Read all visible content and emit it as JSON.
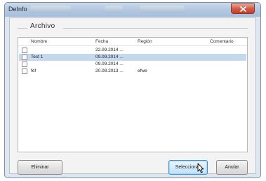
{
  "window": {
    "title": "DeInfo"
  },
  "group": {
    "title": "Archivo"
  },
  "list": {
    "columns": [
      "Nombre",
      "Fecha",
      "Región",
      "Comentario"
    ],
    "rows": [
      {
        "nombre": "",
        "fecha": "22.09.2014 ...",
        "region": "",
        "comentario": ""
      },
      {
        "nombre": "Test 1",
        "fecha": "09.09.2014 ...",
        "region": "",
        "comentario": ""
      },
      {
        "nombre": "",
        "fecha": "09.09.2014 ...",
        "region": "",
        "comentario": ""
      },
      {
        "nombre": "fef",
        "fecha": "20.08.2013 ...",
        "region": "efwe",
        "comentario": ""
      }
    ],
    "selected_row": "Test 1"
  },
  "buttons": {
    "eliminar": "Eliminar",
    "seleccionar": "Seleccionar",
    "anular": "Anular"
  },
  "icons": {
    "close": "close-x-icon",
    "checkbox": "checkbox-icon",
    "cursor": "mouse-pointer-icon"
  }
}
